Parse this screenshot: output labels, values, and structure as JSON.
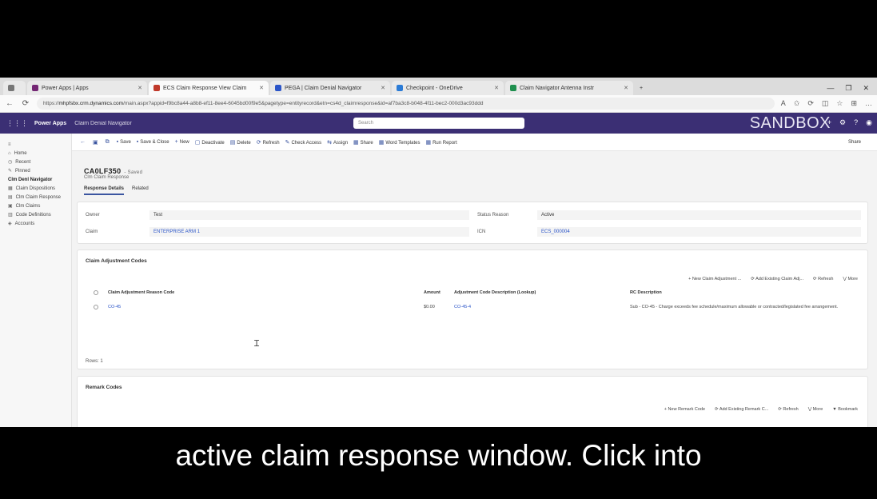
{
  "browser": {
    "tabs": [
      {
        "label": "Power Apps | Apps",
        "active": false,
        "color": "#742774"
      },
      {
        "label": "ECS Claim Response View Claim",
        "active": true,
        "color": "#c0392b"
      },
      {
        "label": "PEGA | Claim Denial Navigator",
        "active": false,
        "color": "#2b55c8"
      },
      {
        "label": "Checkpoint - OneDrive",
        "active": false,
        "color": "#2b7bd6"
      },
      {
        "label": "Claim Navigator Antenna Instr",
        "active": false,
        "color": "#1e8f4e"
      }
    ],
    "new_tab": "+",
    "window_controls": [
      "—",
      "❐",
      "✕"
    ],
    "url_prefix": "https://",
    "url_host": "mhpfsbx.crm.dynamics.com",
    "url_rest": "/main.aspx?appid=f9bc8a44-a8b8-ef11-8ee4-6045bd00f9e5&pagetype=entityrecord&etn=cs4d_claimresponse&id=af7ba3c8-b048-4f11-bec2-000d3ac93ddd",
    "address_icons": [
      "A",
      "✩",
      "⟳",
      "◫",
      "☆",
      "⊞",
      "…"
    ]
  },
  "app": {
    "grid_glyph": "⋮⋮⋮",
    "name": "Power Apps",
    "sub": "Claim Denial Navigator",
    "search_placeholder": "Search",
    "environment": "SANDBOX",
    "header_icons": [
      "+",
      "⚙",
      "?",
      "◉"
    ]
  },
  "leftnav": {
    "items": [
      {
        "icon": "≡",
        "label": "",
        "group": false
      },
      {
        "icon": "⌂",
        "label": "Home",
        "group": false
      },
      {
        "icon": "◷",
        "label": "Recent",
        "group": false
      },
      {
        "icon": "✎",
        "label": "Pinned",
        "group": false
      },
      {
        "icon": "",
        "label": "Clm Denl Navigator",
        "group": true
      },
      {
        "icon": "▦",
        "label": "Claim Dispositions",
        "group": false
      },
      {
        "icon": "▤",
        "label": "Clm Claim Response",
        "group": false
      },
      {
        "icon": "▣",
        "label": "Clm Claims",
        "group": false
      },
      {
        "icon": "▥",
        "label": "Code Definitions",
        "group": false
      },
      {
        "icon": "◈",
        "label": "Accounts",
        "group": false
      }
    ]
  },
  "cmdbar": {
    "items": [
      {
        "icon": "←",
        "label": ""
      },
      {
        "icon": "▣",
        "label": ""
      },
      {
        "icon": "⧉",
        "label": ""
      },
      {
        "icon": "▪",
        "label": "Save"
      },
      {
        "icon": "▪",
        "label": "Save & Close"
      },
      {
        "icon": "+",
        "label": "New"
      },
      {
        "icon": "▢",
        "label": "Deactivate"
      },
      {
        "icon": "▤",
        "label": "Delete"
      },
      {
        "icon": "⟳",
        "label": "Refresh"
      },
      {
        "icon": "✎",
        "label": "Check Access"
      },
      {
        "icon": "⇆",
        "label": "Assign"
      },
      {
        "icon": "▦",
        "label": "Share"
      },
      {
        "icon": "▦",
        "label": "Word Templates"
      },
      {
        "icon": "▦",
        "label": "Run Report"
      }
    ],
    "share_label": "Share"
  },
  "record": {
    "title": "CA0LF350",
    "title_suffix": "- Saved",
    "subtitle": "Clm Claim Response",
    "tabs": [
      "Response Details",
      "Related"
    ]
  },
  "general": {
    "fields": [
      {
        "label": "Owner",
        "value": "Test"
      },
      {
        "label": "Claim",
        "value": "ENTERPRISE ARM 1",
        "link": true
      }
    ],
    "right_fields": [
      {
        "label": "Status Reason",
        "value": "Active"
      },
      {
        "label": "ICN",
        "value": "ECS_000004",
        "link": true
      }
    ]
  },
  "adjustment_grid": {
    "title": "Claim Adjustment Codes",
    "commands": [
      "+ New Claim Adjustment ...",
      "⟳ Add Existing Claim Adj...",
      "⟳ Refresh",
      "⋁ More"
    ],
    "columns": [
      "Claim Adjustment Reason Code",
      "Amount",
      "Adjustment Code Description (Lookup)",
      "RC Description"
    ],
    "rows": [
      {
        "code": "CO-45",
        "amount": "$0.00",
        "desc": "CO-45-4",
        "rc": "Sub - CO-45 - Charge exceeds fee schedule/maximum allowable or contracted/legislated fee arrangement."
      }
    ],
    "footer": "Rows: 1"
  },
  "remark_grid": {
    "title": "Remark Codes",
    "commands": [
      "+ New Remark Code",
      "⟳ Add Existing Remark C...",
      "⟳ Refresh",
      "⋁ More",
      "▼ Bookmark"
    ]
  },
  "caption": "active claim response window. Click into"
}
